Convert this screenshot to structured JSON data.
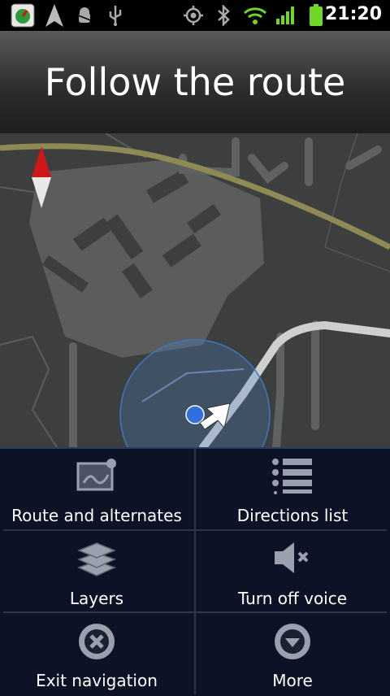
{
  "status_bar": {
    "time": "21:20",
    "icons": [
      "app-notification-icon",
      "navigation-arrow-icon",
      "android-debug-icon",
      "usb-icon",
      "gps-icon",
      "bluetooth-icon",
      "wifi-icon",
      "signal-icon",
      "battery-icon"
    ]
  },
  "header": {
    "title": "Follow the route"
  },
  "map": {
    "route_color": "#cfcfcf",
    "road_highlight_color": "#8f8a55"
  },
  "menu": {
    "items": [
      {
        "label": "Route and alternates",
        "icon": "route-map-icon"
      },
      {
        "label": "Directions list",
        "icon": "list-icon"
      },
      {
        "label": "Layers",
        "icon": "layers-icon"
      },
      {
        "label": "Turn off voice",
        "icon": "speaker-mute-icon"
      },
      {
        "label": "Exit navigation",
        "icon": "close-circle-icon"
      },
      {
        "label": "More",
        "icon": "chevron-down-circle-icon"
      }
    ]
  }
}
